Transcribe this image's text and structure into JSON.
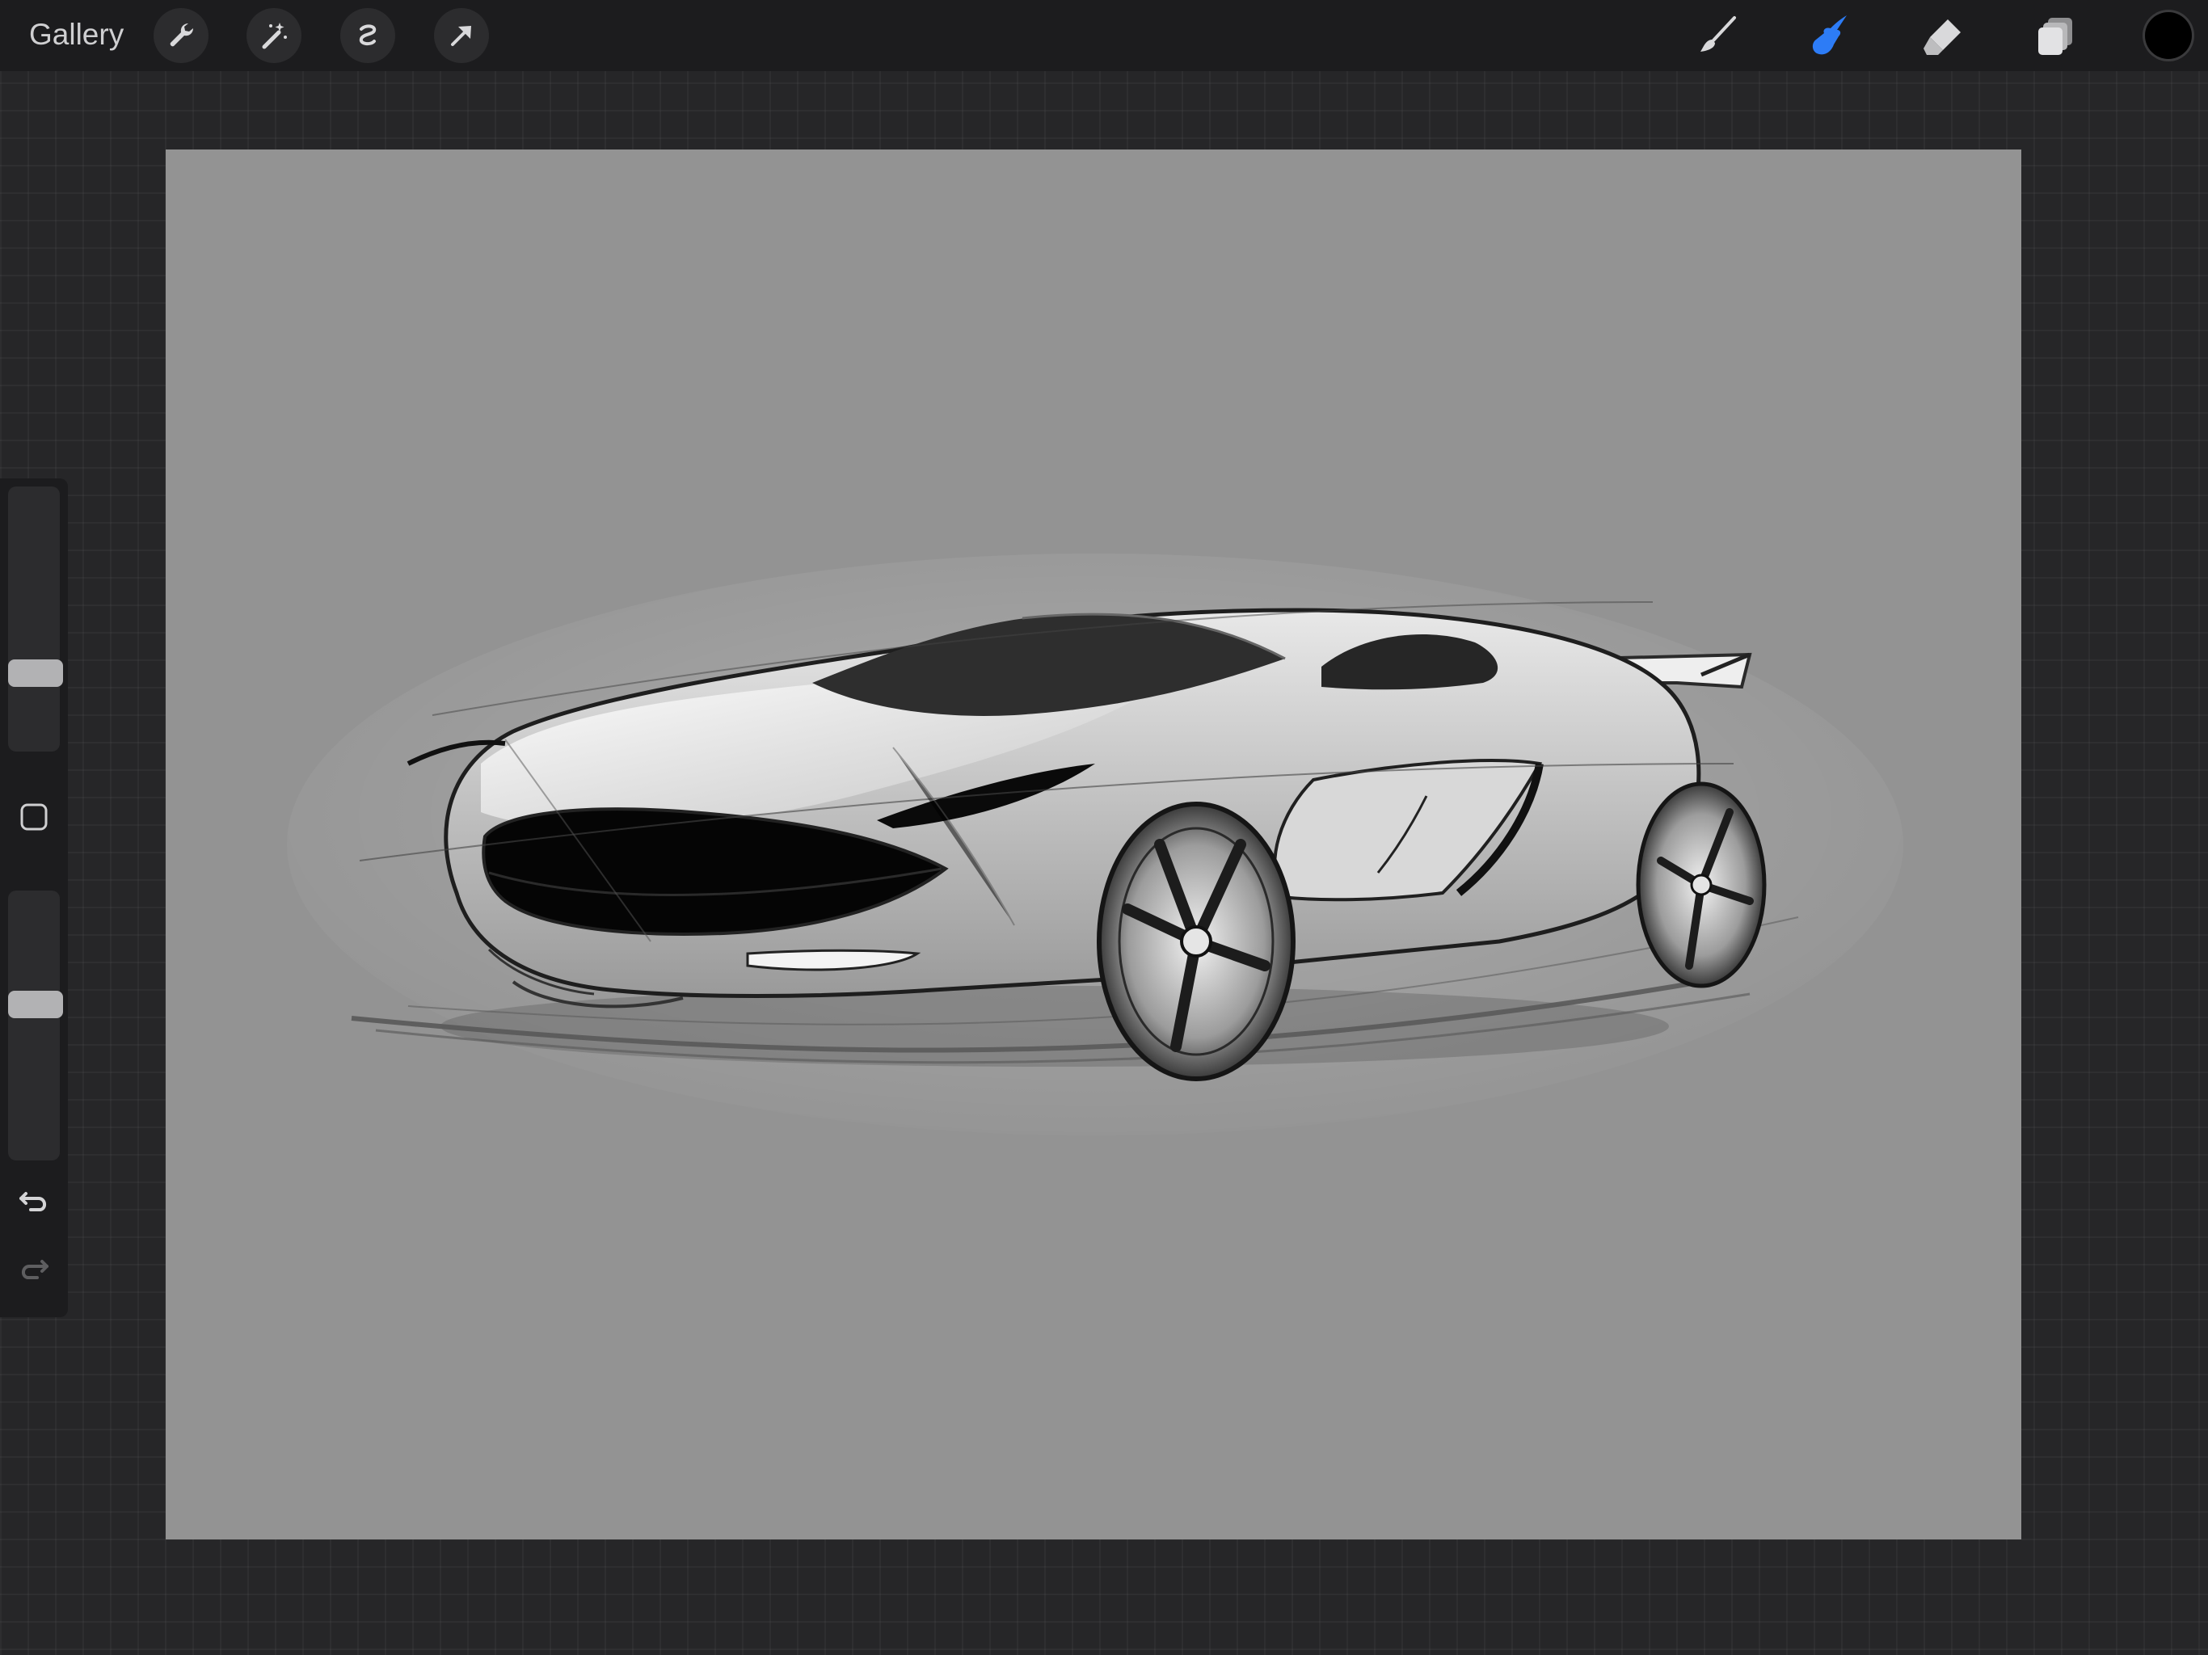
{
  "app": {
    "gallery_label": "Gallery"
  },
  "toolbar": {
    "actions": [
      {
        "icon": "wrench-icon",
        "name": "actions"
      },
      {
        "icon": "magic-wand-icon",
        "name": "adjustments"
      },
      {
        "icon": "selection-icon",
        "name": "selection"
      },
      {
        "icon": "transform-arrow-icon",
        "name": "transform"
      }
    ],
    "tools": [
      {
        "icon": "brush-icon",
        "name": "paint",
        "active": false
      },
      {
        "icon": "smudge-finger-icon",
        "name": "smudge",
        "active": true
      },
      {
        "icon": "eraser-icon",
        "name": "eraser",
        "active": false
      },
      {
        "icon": "layers-icon",
        "name": "layers",
        "active": false
      }
    ],
    "active_tool_color": "#2d7cf6",
    "current_color": "#000000"
  },
  "sidebar": {
    "brush_size": 0.35,
    "brush_opacity": 0.58,
    "undo_enabled": true,
    "redo_enabled": false
  },
  "canvas": {
    "background_color": "#939393",
    "artwork": "car-sketch"
  }
}
